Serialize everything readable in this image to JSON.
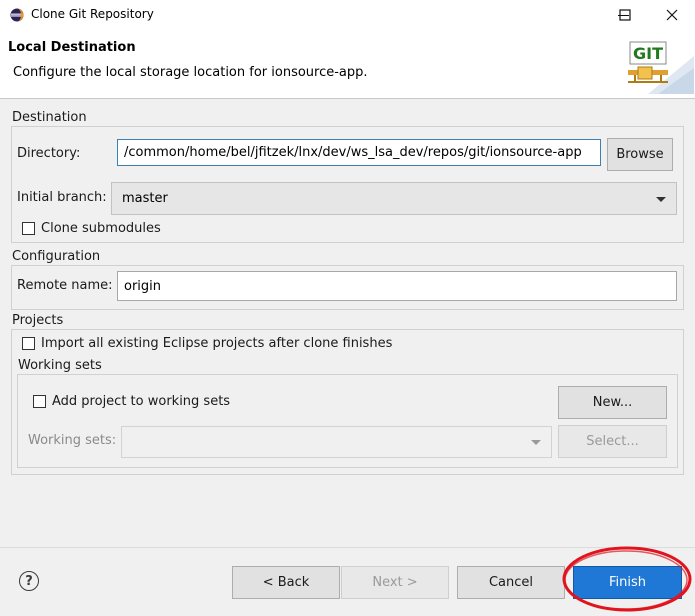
{
  "window": {
    "title": "Clone Git Repository",
    "icon": "eclipse-icon",
    "controls": [
      "minimize-icon",
      "maximize-icon",
      "close-icon"
    ]
  },
  "header": {
    "title": "Local Destination",
    "description": "Configure the local storage location for ionsource-app.",
    "logo_text": "GIT"
  },
  "destination": {
    "group_label": "Destination",
    "directory_label": "Directory:",
    "directory_value": "/common/home/bel/jfitzek/lnx/dev/ws_lsa_dev/repos/git/ionsource-app",
    "browse_label": "Browse",
    "initial_branch_label": "Initial branch:",
    "initial_branch_value": "master",
    "clone_submodules_label": "Clone submodules",
    "clone_submodules_checked": false
  },
  "configuration": {
    "group_label": "Configuration",
    "remote_name_label": "Remote name:",
    "remote_name_value": "origin"
  },
  "projects": {
    "group_label": "Projects",
    "import_label": "Import all existing Eclipse projects after clone finishes",
    "import_checked": false,
    "working_sets": {
      "group_label": "Working sets",
      "add_label": "Add project to working sets",
      "add_checked": false,
      "new_label": "New...",
      "working_sets_label": "Working sets:",
      "working_sets_value": "",
      "select_label": "Select..."
    }
  },
  "footer": {
    "help_icon": "?",
    "back_label": "< Back",
    "next_label": "Next >",
    "cancel_label": "Cancel",
    "finish_label": "Finish"
  },
  "colors": {
    "accent": "#1f78d6",
    "annotation": "#e0141e",
    "focus_border": "#3c7fb1"
  }
}
